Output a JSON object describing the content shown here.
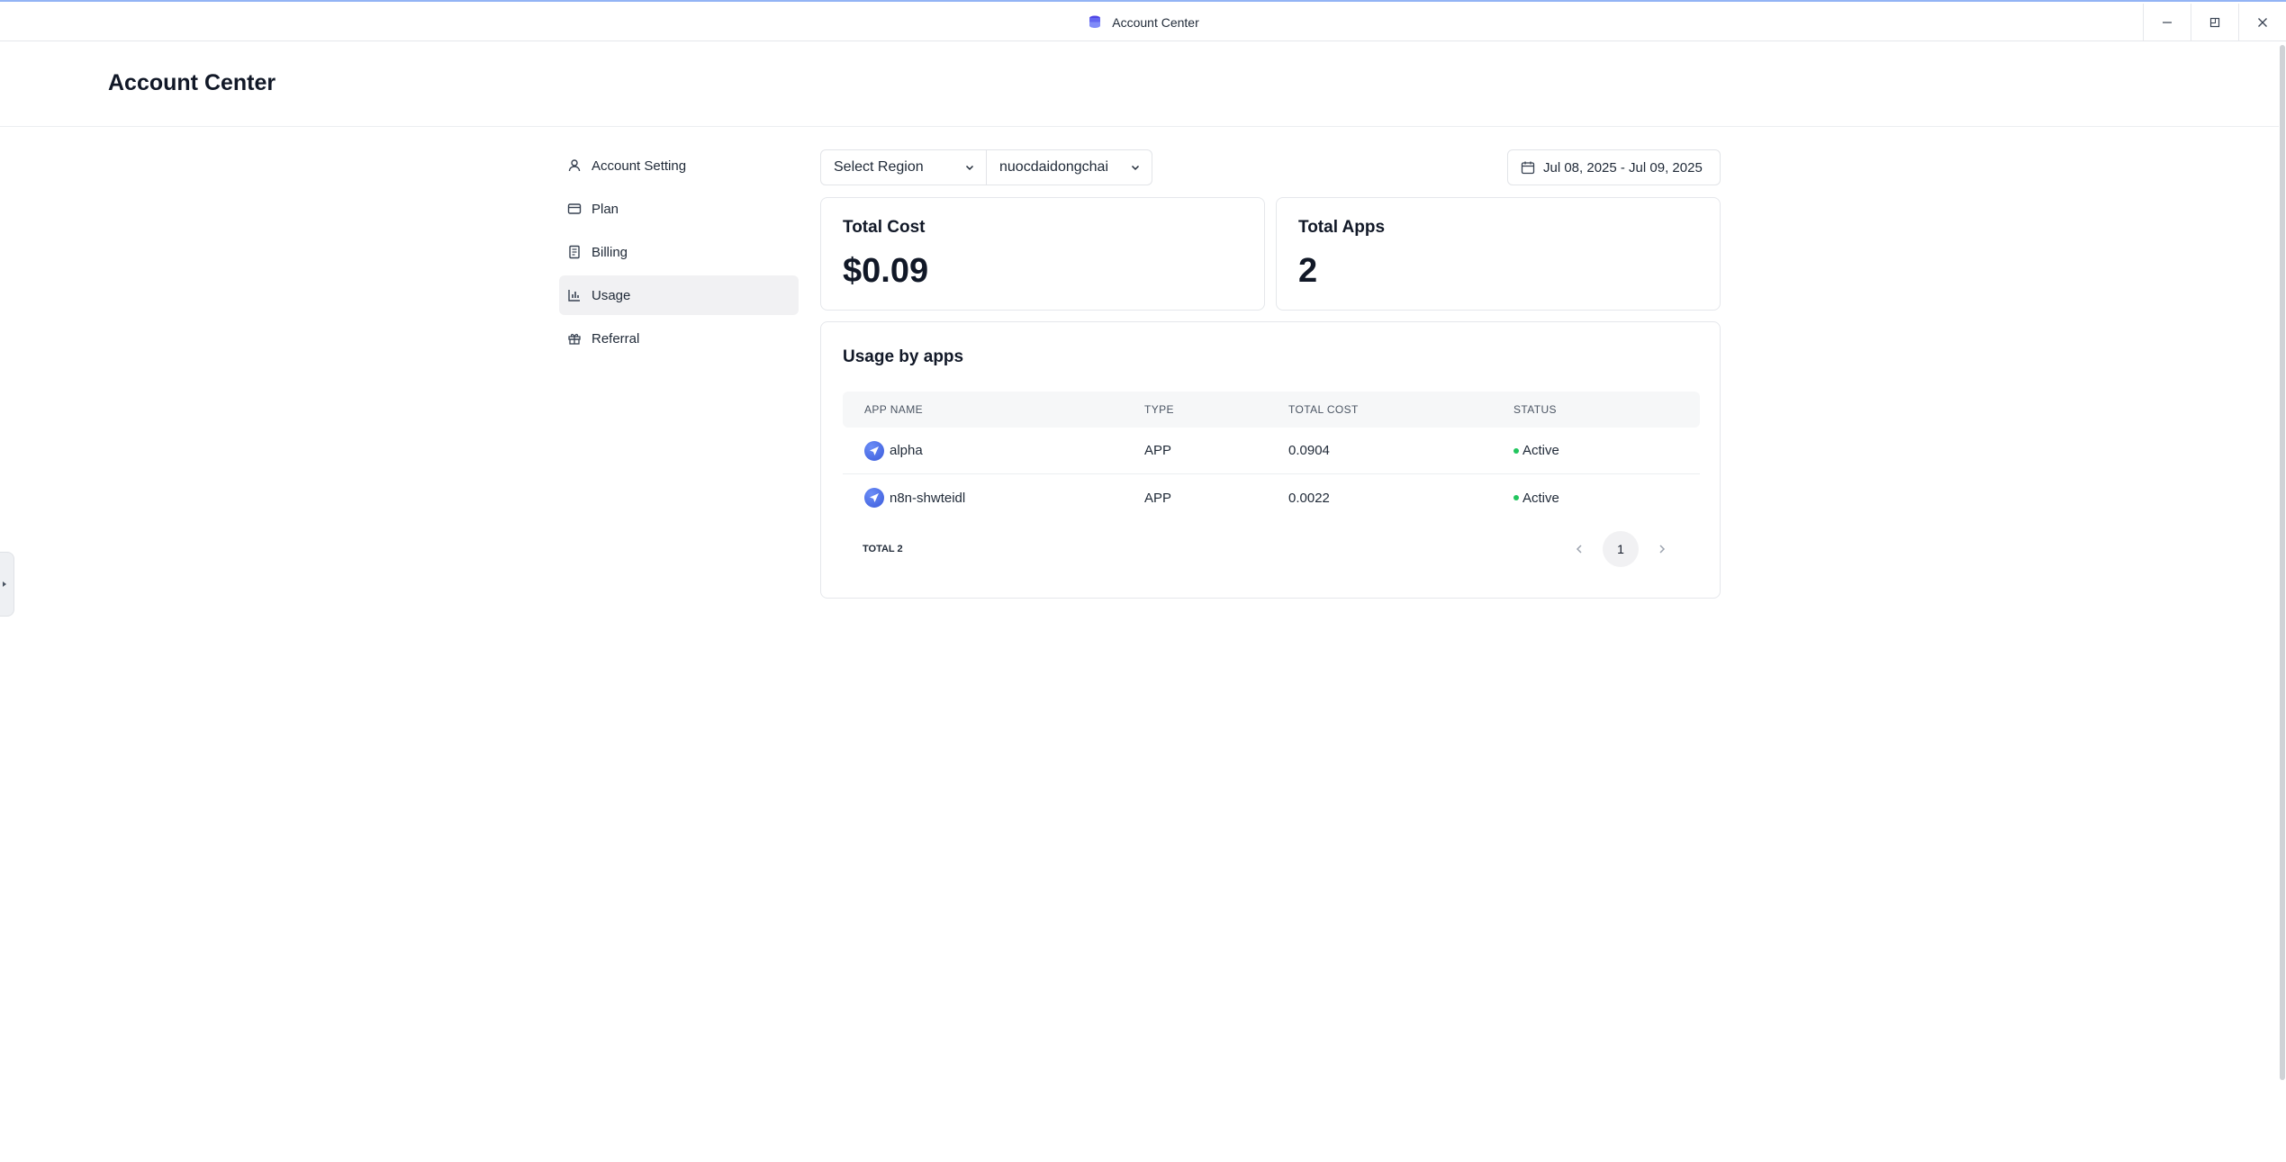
{
  "window": {
    "title": "Account Center",
    "controls": {
      "minimize": "—",
      "maximize": "◫",
      "close": "✕"
    }
  },
  "header": {
    "title": "Account Center"
  },
  "sidebar": {
    "items": [
      {
        "label": "Account Setting",
        "icon": "user-icon",
        "active": false
      },
      {
        "label": "Plan",
        "icon": "credit-card-icon",
        "active": false
      },
      {
        "label": "Billing",
        "icon": "receipt-icon",
        "active": false
      },
      {
        "label": "Usage",
        "icon": "bar-chart-icon",
        "active": true
      },
      {
        "label": "Referral",
        "icon": "gift-icon",
        "active": false
      }
    ]
  },
  "filters": {
    "region": "Select Region",
    "account": "nuocdaidongchai",
    "date_range": "Jul 08, 2025 - Jul 09, 2025"
  },
  "stats": {
    "total_cost_label": "Total Cost",
    "total_cost_value": "$0.09",
    "total_apps_label": "Total Apps",
    "total_apps_value": "2"
  },
  "usage": {
    "title": "Usage by apps",
    "columns": [
      "APP NAME",
      "TYPE",
      "TOTAL COST",
      "STATUS"
    ],
    "rows": [
      {
        "name": "alpha",
        "type": "APP",
        "cost": "0.0904",
        "status": "Active"
      },
      {
        "name": "n8n-shwteidl",
        "type": "APP",
        "cost": "0.0022",
        "status": "Active"
      }
    ],
    "total_label": "TOTAL 2",
    "current_page": "1"
  },
  "colors": {
    "accent": "#3b5bdb",
    "status_active": "#22c55e",
    "active_nav_bg": "#f1f1f3"
  }
}
